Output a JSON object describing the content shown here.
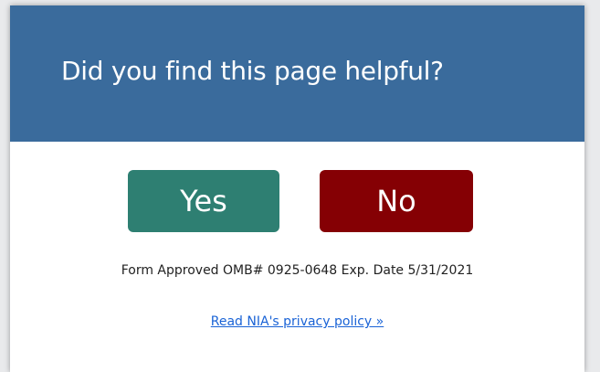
{
  "feedback": {
    "title": "Did you find this page helpful?",
    "yes_label": "Yes",
    "no_label": "No",
    "omb_text": "Form Approved OMB# 0925-0648 Exp. Date 5/31/2021",
    "privacy_link_text": "Read NIA's privacy policy »"
  },
  "colors": {
    "header_bg": "#3a6b9c",
    "yes_bg": "#2e7f72",
    "no_bg": "#850004",
    "link": "#1a63d6"
  }
}
